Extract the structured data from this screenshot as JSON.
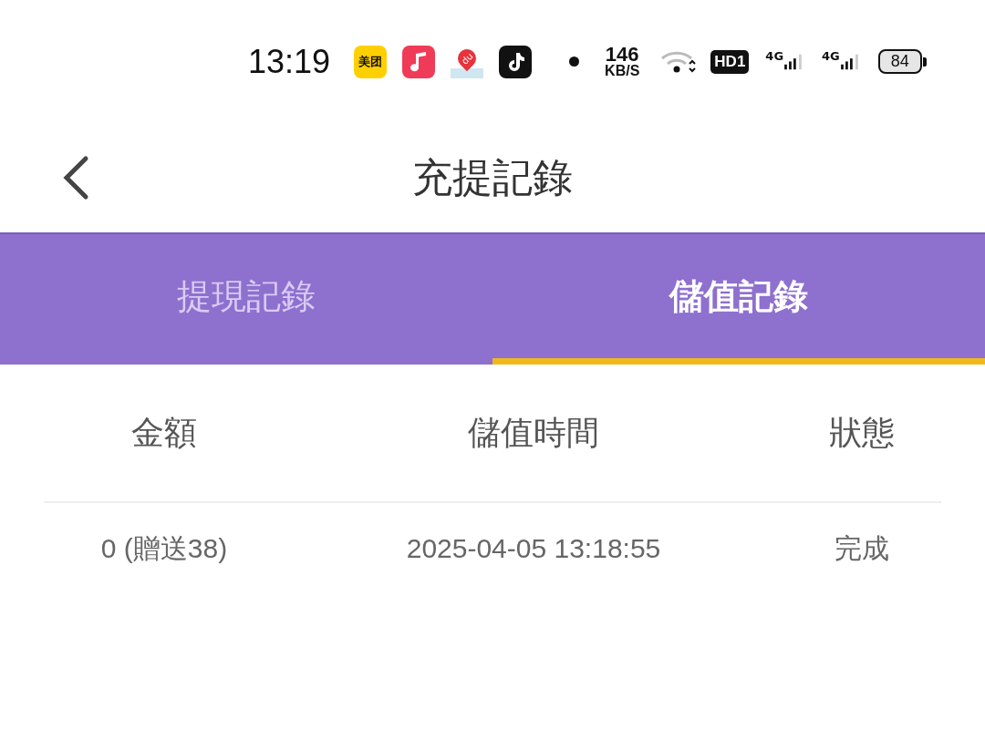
{
  "status_bar": {
    "time": "13:19",
    "app_icons": [
      {
        "kind": "meituan",
        "label": "美团"
      },
      {
        "kind": "music"
      },
      {
        "kind": "map",
        "label": "du"
      },
      {
        "kind": "tiktok"
      }
    ],
    "speed": "146",
    "speed_unit": "KB/S",
    "hd": "HD1",
    "networks": [
      "4G",
      "4G"
    ],
    "battery": "84"
  },
  "header": {
    "title": "充提記錄"
  },
  "tabs": [
    {
      "label": "提現記錄",
      "selected": false
    },
    {
      "label": "儲值記錄",
      "selected": true
    }
  ],
  "table": {
    "columns": [
      "金額",
      "儲值時間",
      "狀態"
    ],
    "rows": [
      [
        "0 (贈送38)",
        "2025-04-05 13:18:55",
        "完成"
      ]
    ]
  }
}
